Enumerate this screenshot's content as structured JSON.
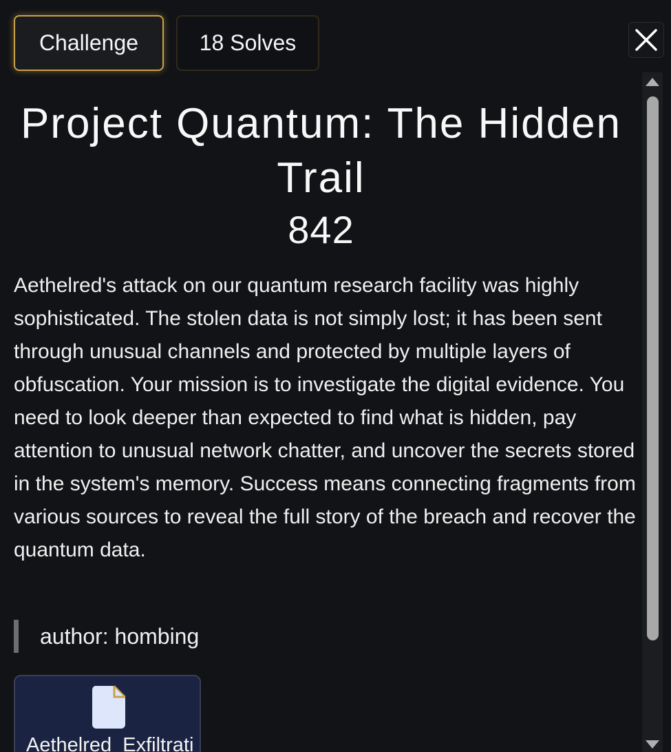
{
  "tabs": [
    {
      "label": "Challenge",
      "active": true
    },
    {
      "label": "18 Solves",
      "active": false
    }
  ],
  "close_icon": "close-x-icon",
  "challenge": {
    "title": "Project Quantum: The Hidden Trail",
    "points": "842",
    "description": "Aethelred's attack on our quantum research facility was highly sophisticated. The stolen data is not simply lost; it has been sent through unusual channels and protected by multiple layers of obfuscation. Your mission is to investigate the digital evidence. You need to look deeper than expected to find what is hidden, pay attention to unusual network chatter, and uncover the secrets stored in the system's memory. Success means connecting fragments from various sources to reveal the full story of the breach and recover the quantum data.",
    "author": "author: hombing"
  },
  "files": [
    {
      "name": "Aethelred_Exfiltrati",
      "icon": "file-icon"
    }
  ],
  "colors": {
    "background": "#121316",
    "accent_border": "#c9a24a",
    "file_card": "#1a2342"
  }
}
